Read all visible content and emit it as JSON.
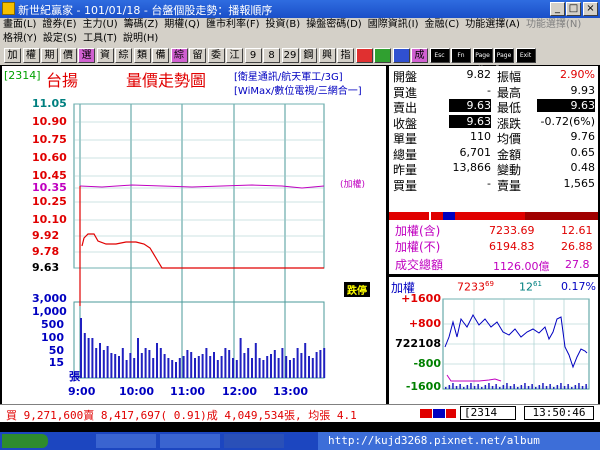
{
  "window": {
    "title": "新世紀贏家 - 101/01/18 - 台盤個股走勢：播報順序"
  },
  "menu1": [
    "畫面(L)",
    "證券(E)",
    "主力(U)",
    "籌碼(Z)",
    "期權(Q)",
    "匯市利率(F)",
    "投資(B)",
    "操盤密碼(D)",
    "國際資訊(I)",
    "金融(C)",
    "功能選擇(A)",
    "功能選擇(N)"
  ],
  "menu2": [
    "格視(Y)",
    "設定(S)",
    "工具(T)",
    "說明(H)"
  ],
  "toolbar": [
    "加",
    "權",
    "期",
    "價",
    "選",
    "資",
    "綜",
    "類",
    "備",
    "綜",
    "留",
    "委",
    "江",
    "9",
    "8",
    "29",
    "鋼",
    "興",
    "指",
    "",
    "",
    "",
    "成",
    "Esc",
    "Fn",
    "Page Up",
    "Page Down",
    "Exit"
  ],
  "chart": {
    "code": "[2314]",
    "name": "台揚",
    "title": "量價走勢圖",
    "desc1": "[衛星通訊/航天軍工/3G]",
    "desc2": "[WiMax/數位電視/三網合一]",
    "ref_label": "(加權)",
    "price_ticks": [
      "11.05",
      "10.90",
      "10.75",
      "10.60",
      "10.45",
      "10.35",
      "10.25",
      "10.10",
      "9.92",
      "9.78",
      "9.63"
    ],
    "price_colors": [
      "#008080",
      "#e00000",
      "#e00000",
      "#e00000",
      "#e00000",
      "#c000c0",
      "#e00000",
      "#e00000",
      "#e00000",
      "#e00000",
      "#000000"
    ],
    "vol_ticks": [
      "3,000",
      "1,000",
      "500",
      "100",
      "50",
      "15",
      "張"
    ],
    "time_ticks": [
      "9:00",
      "10:00",
      "11:00",
      "12:00",
      "13:00"
    ],
    "limit_badge": "跌停"
  },
  "quote": {
    "rows": [
      {
        "l1": "開盤",
        "v1": "9.82",
        "l2": "振幅",
        "v2": "2.90%",
        "c1": "#000",
        "c2": "#e00000"
      },
      {
        "l1": "買進",
        "v1": "-",
        "l2": "最高",
        "v2": "9.93",
        "c1": "#000",
        "c2": "#000"
      },
      {
        "l1": "賣出",
        "v1": "9.63",
        "l2": "最低",
        "v2": "9.63",
        "c1": "hl",
        "c2": "hl"
      },
      {
        "l1": "收盤",
        "v1": "9.63",
        "l2": "漲跌",
        "v2": "-0.72(6%)",
        "c1": "hl",
        "c2": "#000"
      },
      {
        "l1": "單量",
        "v1": "110",
        "l2": "均價",
        "v2": "9.76",
        "c1": "#000",
        "c2": "#000"
      },
      {
        "l1": "總量",
        "v1": "6,701",
        "l2": "金額",
        "v2": "0.65",
        "c1": "#000",
        "c2": "#000"
      },
      {
        "l1": "昨量",
        "v1": "13,866",
        "l2": "變動",
        "v2": "0.48",
        "c1": "#000",
        "c2": "#000"
      },
      {
        "l1": "買量",
        "v1": "-",
        "l2": "賣量",
        "v2": "1,565",
        "c1": "#000",
        "c2": "#000"
      }
    ]
  },
  "index": {
    "r1_label": "加權(含)",
    "r1_val": "7233.69",
    "r1_chg": "12.61",
    "r2_label": "加權(不)",
    "r2_val": "6194.83",
    "r2_chg": "26.88",
    "r3_label": "成交總額",
    "r3_val": "1126.00億",
    "r3_chg": "27.8"
  },
  "mini": {
    "label": "加權",
    "value": "7233",
    "value_sup": "69",
    "chg": "12",
    "chg_sup": "61",
    "pct": "0.17%",
    "ticks": [
      "+1600",
      "+800",
      "722108",
      "-800",
      "-1600"
    ]
  },
  "status": {
    "text": "買 9,271,600賣 8,417,697( 0.91)成 4,049,534張, 均張 4.1",
    "input": "2314",
    "clock": "13:50:46"
  },
  "taskbar": {
    "url": "http://kujd3268.pixnet.net/album"
  }
}
